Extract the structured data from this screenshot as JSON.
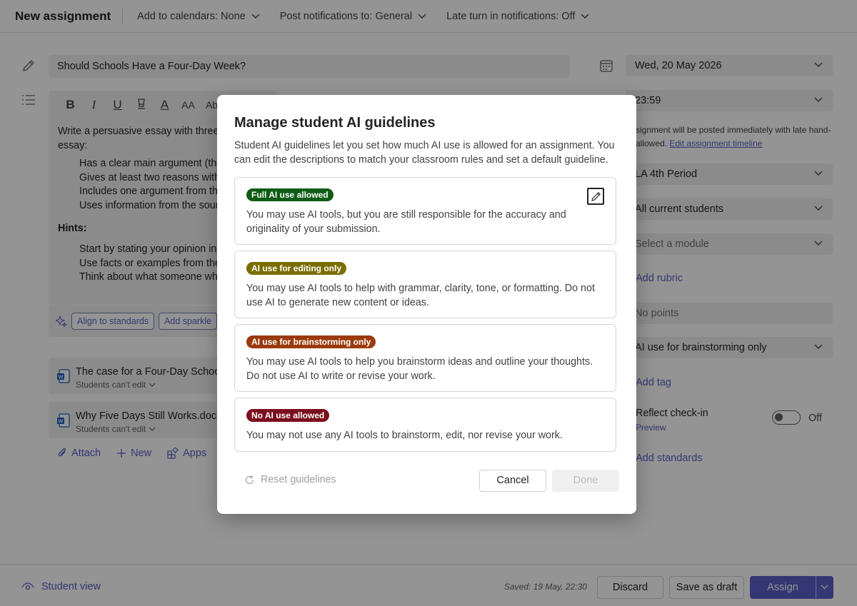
{
  "header": {
    "title": "New assignment",
    "calendars": "Add to calendars: None",
    "notifications": "Post notifications to: General",
    "late": "Late turn in notifications: Off"
  },
  "form": {
    "title_value": "Should Schools Have a Four-Day Week?",
    "toolbar_icons": [
      "bold-icon",
      "italic-icon",
      "underline-icon",
      "highlight-icon",
      "font-color-icon",
      "font-size-icon",
      "strikethrough-icon"
    ],
    "toolbar_glyphs": [
      "B",
      "I",
      "U",
      "",
      "A",
      "AA",
      "Ab"
    ],
    "instructions_intro": "Write a persuasive essay with three p",
    "instructions_intro2": "essay:",
    "bullets": [
      "Has a clear main argument (thes",
      "Gives at least two reasons with e",
      "Includes one argument from the",
      "Uses information from the sourc"
    ],
    "hints_label": "Hints:",
    "hints": [
      "Start by stating your opinion in t",
      "Use facts or examples from the s",
      "Think about what someone who"
    ],
    "chips": [
      "Align to standards",
      "Add sparkle"
    ]
  },
  "attachments": [
    {
      "name": "The case for a Four-Day School W",
      "sub": "Students can't edit"
    },
    {
      "name": "Why Five Days Still Works.docx",
      "sub": "Students can't edit"
    }
  ],
  "actions": {
    "attach": "Attach",
    "new": "New",
    "apps": "Apps"
  },
  "right": {
    "due_date": "Wed, 20 May 2026",
    "due_time": "23:59",
    "note": "signment will be posted immediately with late hand-",
    "note2": "allowed.",
    "note_link": "Edit assignment timeline",
    "class": "LA 4th Period",
    "students": "All current students",
    "module": "Select a module",
    "rubric": "Add rubric",
    "points": "No points",
    "ai_guideline": "AI use for brainstorming only",
    "tag": "Add tag",
    "reflect": "Reflect check-in",
    "preview": "Preview",
    "toggle_state": "Off",
    "standards": "Add standards"
  },
  "footer": {
    "student_view": "Student view",
    "saved": "Saved: 19 May, 22:30",
    "discard": "Discard",
    "save_draft": "Save as draft",
    "assign": "Assign"
  },
  "modal": {
    "title": "Manage student AI guidelines",
    "description": "Student AI guidelines let you set how much AI use is allowed for an assignment. You can edit the descriptions to match your classroom rules and set a default guideline.",
    "guidelines": [
      {
        "badge": "Full AI use allowed",
        "color": "#0e5c16",
        "text": "You may use AI tools, but you are still responsible for the accuracy and originality of your submission."
      },
      {
        "badge": "AI use for editing only",
        "color": "#7a6d00",
        "text": "You may use AI tools to help with grammar, clarity, tone, or formatting. Do not use AI to generate new content or ideas."
      },
      {
        "badge": "AI use for brainstorming only",
        "color": "#9b3a0c",
        "text": "You may use AI tools to help you brainstorm ideas and outline your thoughts. Do not use AI to write or revise your work."
      },
      {
        "badge": "No AI use allowed",
        "color": "#7a0f1d",
        "text": "You may not use any AI tools to brainstorm, edit, nor revise your work."
      }
    ],
    "reset": "Reset guidelines",
    "cancel": "Cancel",
    "done": "Done"
  }
}
